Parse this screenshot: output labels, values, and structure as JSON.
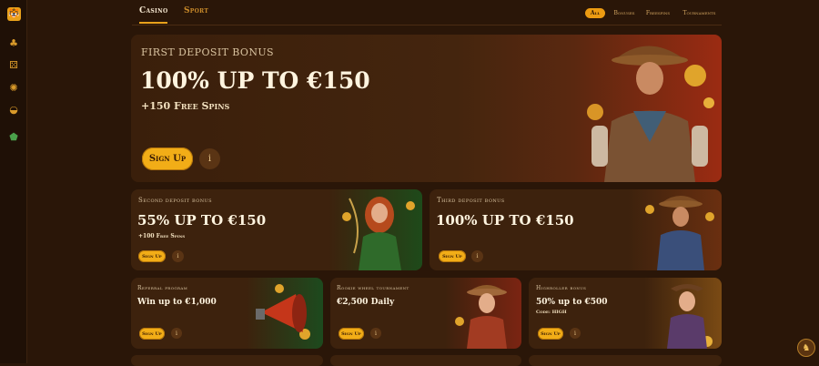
{
  "colors": {
    "accent": "#f2ad17",
    "background": "#2a1608",
    "card": "#3d220d"
  },
  "sidebar": {
    "logo_icon": "tiger-logo-icon",
    "items": [
      {
        "icon": "poker-chip-icon",
        "glyph": "♣"
      },
      {
        "icon": "dice-icon",
        "glyph": "⚄"
      },
      {
        "icon": "roulette-icon",
        "glyph": "✺"
      },
      {
        "icon": "controller-icon",
        "glyph": "◒"
      },
      {
        "icon": "shield-icon",
        "glyph": "⬟"
      }
    ]
  },
  "header": {
    "tabs": [
      {
        "label": "Casino"
      },
      {
        "label": "Sport"
      }
    ],
    "filters": [
      {
        "label": "All"
      },
      {
        "label": "Bonuses"
      },
      {
        "label": "Freespins"
      },
      {
        "label": "Tournaments"
      }
    ]
  },
  "hero": {
    "kicker": "FIRST DEPOSIT BONUS",
    "title": "100% UP TO €150",
    "subtitle": "+150 Free Spins",
    "button": "Sign Up",
    "info_glyph": "i"
  },
  "cards": [
    {
      "kicker": "Second deposit bonus",
      "title": "55% UP TO €150",
      "subtitle": "+100 Free Spins",
      "button": "Sign Up"
    },
    {
      "kicker": "Third deposit bonus",
      "title": "100% UP TO €150",
      "subtitle": "",
      "button": "Sign Up"
    },
    {
      "kicker": "Referral program",
      "title": "Win up to €1,000",
      "subtitle": "",
      "button": "Sign Up"
    },
    {
      "kicker": "Rookie wheel tournament",
      "title": "€2,500 Daily",
      "subtitle": "",
      "button": "Sign Up"
    },
    {
      "kicker": "Highroller bonus",
      "title": "50% up to €500",
      "subtitle": "Code: HIGH",
      "button": "Sign Up"
    }
  ],
  "chat": {
    "glyph": "♞"
  }
}
